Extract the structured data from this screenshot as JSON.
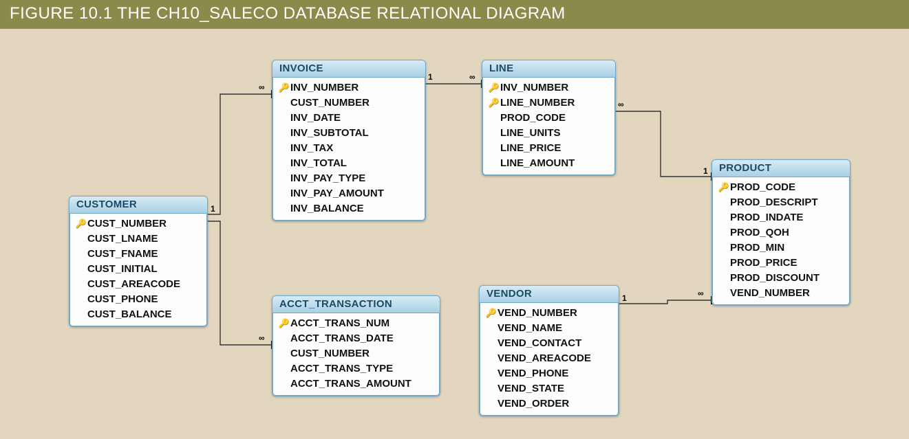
{
  "banner": "FIGURE 10.1  THE CH10_SALECO DATABASE RELATIONAL DIAGRAM",
  "tables": {
    "customer": {
      "title": "CUSTOMER",
      "fields": [
        {
          "name": "CUST_NUMBER",
          "pk": true
        },
        {
          "name": "CUST_LNAME",
          "pk": false
        },
        {
          "name": "CUST_FNAME",
          "pk": false
        },
        {
          "name": "CUST_INITIAL",
          "pk": false
        },
        {
          "name": "CUST_AREACODE",
          "pk": false
        },
        {
          "name": "CUST_PHONE",
          "pk": false
        },
        {
          "name": "CUST_BALANCE",
          "pk": false
        }
      ]
    },
    "invoice": {
      "title": "INVOICE",
      "fields": [
        {
          "name": "INV_NUMBER",
          "pk": true
        },
        {
          "name": "CUST_NUMBER",
          "pk": false
        },
        {
          "name": "INV_DATE",
          "pk": false
        },
        {
          "name": "INV_SUBTOTAL",
          "pk": false
        },
        {
          "name": "INV_TAX",
          "pk": false
        },
        {
          "name": "INV_TOTAL",
          "pk": false
        },
        {
          "name": "INV_PAY_TYPE",
          "pk": false
        },
        {
          "name": "INV_PAY_AMOUNT",
          "pk": false
        },
        {
          "name": "INV_BALANCE",
          "pk": false
        }
      ]
    },
    "line": {
      "title": "LINE",
      "fields": [
        {
          "name": "INV_NUMBER",
          "pk": true
        },
        {
          "name": "LINE_NUMBER",
          "pk": true
        },
        {
          "name": "PROD_CODE",
          "pk": false
        },
        {
          "name": "LINE_UNITS",
          "pk": false
        },
        {
          "name": "LINE_PRICE",
          "pk": false
        },
        {
          "name": "LINE_AMOUNT",
          "pk": false
        }
      ]
    },
    "product": {
      "title": "PRODUCT",
      "fields": [
        {
          "name": "PROD_CODE",
          "pk": true
        },
        {
          "name": "PROD_DESCRIPT",
          "pk": false
        },
        {
          "name": "PROD_INDATE",
          "pk": false
        },
        {
          "name": "PROD_QOH",
          "pk": false
        },
        {
          "name": "PROD_MIN",
          "pk": false
        },
        {
          "name": "PROD_PRICE",
          "pk": false
        },
        {
          "name": "PROD_DISCOUNT",
          "pk": false
        },
        {
          "name": "VEND_NUMBER",
          "pk": false
        }
      ]
    },
    "acct": {
      "title": "ACCT_TRANSACTION",
      "fields": [
        {
          "name": "ACCT_TRANS_NUM",
          "pk": true
        },
        {
          "name": "ACCT_TRANS_DATE",
          "pk": false
        },
        {
          "name": "CUST_NUMBER",
          "pk": false
        },
        {
          "name": "ACCT_TRANS_TYPE",
          "pk": false
        },
        {
          "name": "ACCT_TRANS_AMOUNT",
          "pk": false
        }
      ]
    },
    "vendor": {
      "title": "VENDOR",
      "fields": [
        {
          "name": "VEND_NUMBER",
          "pk": true
        },
        {
          "name": "VEND_NAME",
          "pk": false
        },
        {
          "name": "VEND_CONTACT",
          "pk": false
        },
        {
          "name": "VEND_AREACODE",
          "pk": false
        },
        {
          "name": "VEND_PHONE",
          "pk": false
        },
        {
          "name": "VEND_STATE",
          "pk": false
        },
        {
          "name": "VEND_ORDER",
          "pk": false
        }
      ]
    }
  },
  "relationships": [
    {
      "from": "CUSTOMER",
      "to": "INVOICE",
      "card_from": "1",
      "card_to": "∞"
    },
    {
      "from": "CUSTOMER",
      "to": "ACCT_TRANSACTION",
      "card_from": "1",
      "card_to": "∞"
    },
    {
      "from": "INVOICE",
      "to": "LINE",
      "card_from": "1",
      "card_to": "∞"
    },
    {
      "from": "LINE",
      "to": "PRODUCT",
      "card_from": "∞",
      "card_to": "1"
    },
    {
      "from": "VENDOR",
      "to": "PRODUCT",
      "card_from": "1",
      "card_to": "∞"
    }
  ],
  "glyphs": {
    "one": "1",
    "many": "∞"
  }
}
